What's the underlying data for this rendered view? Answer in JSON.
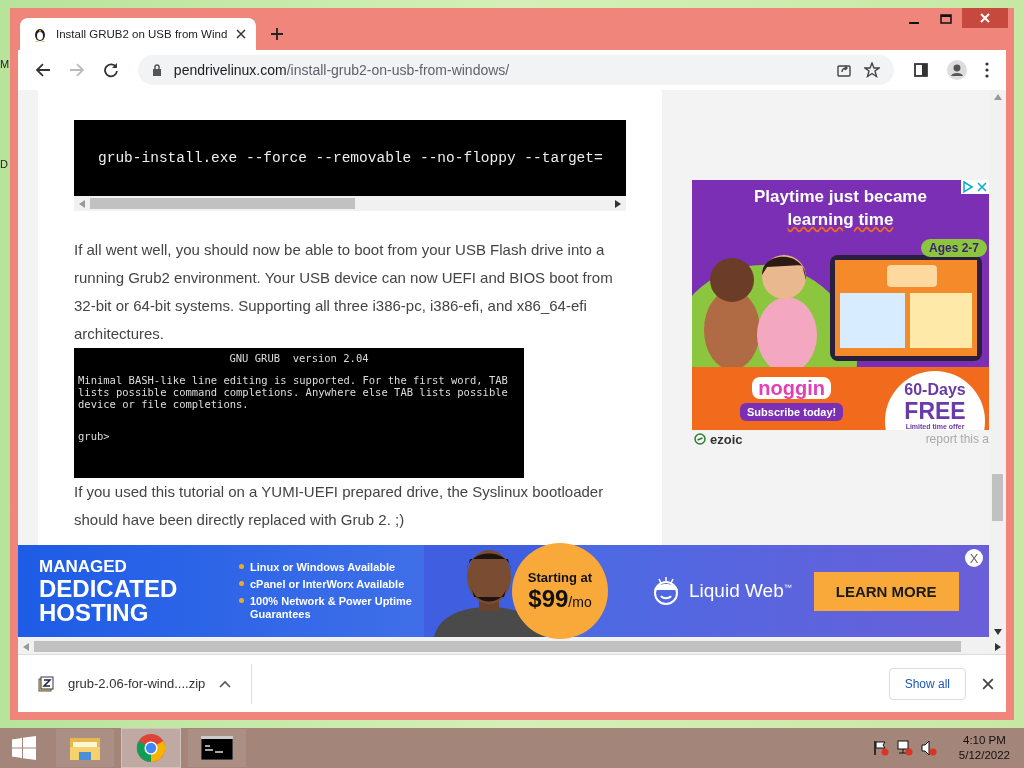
{
  "desktop": {
    "edge_labels": [
      "M",
      "D"
    ]
  },
  "browser": {
    "tab": {
      "title": "Install GRUB2 on USB from Wind",
      "selected": true
    },
    "address": {
      "domain": "pendrivelinux.com",
      "path": "/install-grub2-on-usb-from-windows/"
    },
    "forward_disabled": true
  },
  "article": {
    "code": "grub-install.exe --force --removable --no-floppy --target=",
    "paragraph_1": "If all went well, you should now be able to boot from your USB Flash drive into a running Grub2 environment. Your USB device can now UEFI and BIOS boot from 32-bit or 64-bit systems. Supporting all three i386-pc, i386-efi, and x86_64-efi architectures.",
    "terminal": {
      "title": "GNU GRUB  version 2.04",
      "lines": [
        "Minimal BASH-like line editing is supported. For the first word, TAB",
        "lists possible command completions. Anywhere else TAB lists possible",
        "device or file completions."
      ],
      "prompt": "grub>"
    },
    "paragraph_2": "If you used this tutorial on a YUMI-UEFI prepared drive, the Syslinux bootloader should have been directly replaced with Grub 2. ;)"
  },
  "side_ad": {
    "headline": "Playtime just became",
    "headline_2": "learning time",
    "badge": "Ages 2-7",
    "brand": "noggin",
    "subscribe": "Subscribe today!",
    "offer": "60-Days",
    "offer_2": "FREE",
    "offer_note": "Limited time offer",
    "network": "ezoic",
    "report": "report this a"
  },
  "banner_ad": {
    "heading": [
      "MANAGED",
      "DEDICATED",
      "HOSTING"
    ],
    "bullets": [
      "Linux or Windows Available",
      "cPanel or InterWorx Available",
      "100% Network & Power Uptime Guarantees"
    ],
    "price_label": "Starting at",
    "price": "$99",
    "price_unit": "/mo",
    "brand": "Liquid Web",
    "brand_mark": "™",
    "button": "LEARN MORE",
    "close": "X"
  },
  "downloads": {
    "items": [
      {
        "name": "grub-2.06-for-wind....zip"
      }
    ],
    "show_all": "Show all"
  },
  "taskbar": {
    "apps": [
      {
        "kind": "explorer",
        "selected": false
      },
      {
        "kind": "chrome",
        "selected": true
      },
      {
        "kind": "terminal",
        "selected": false
      }
    ],
    "time": "4:10 PM",
    "date": "5/12/2022"
  }
}
